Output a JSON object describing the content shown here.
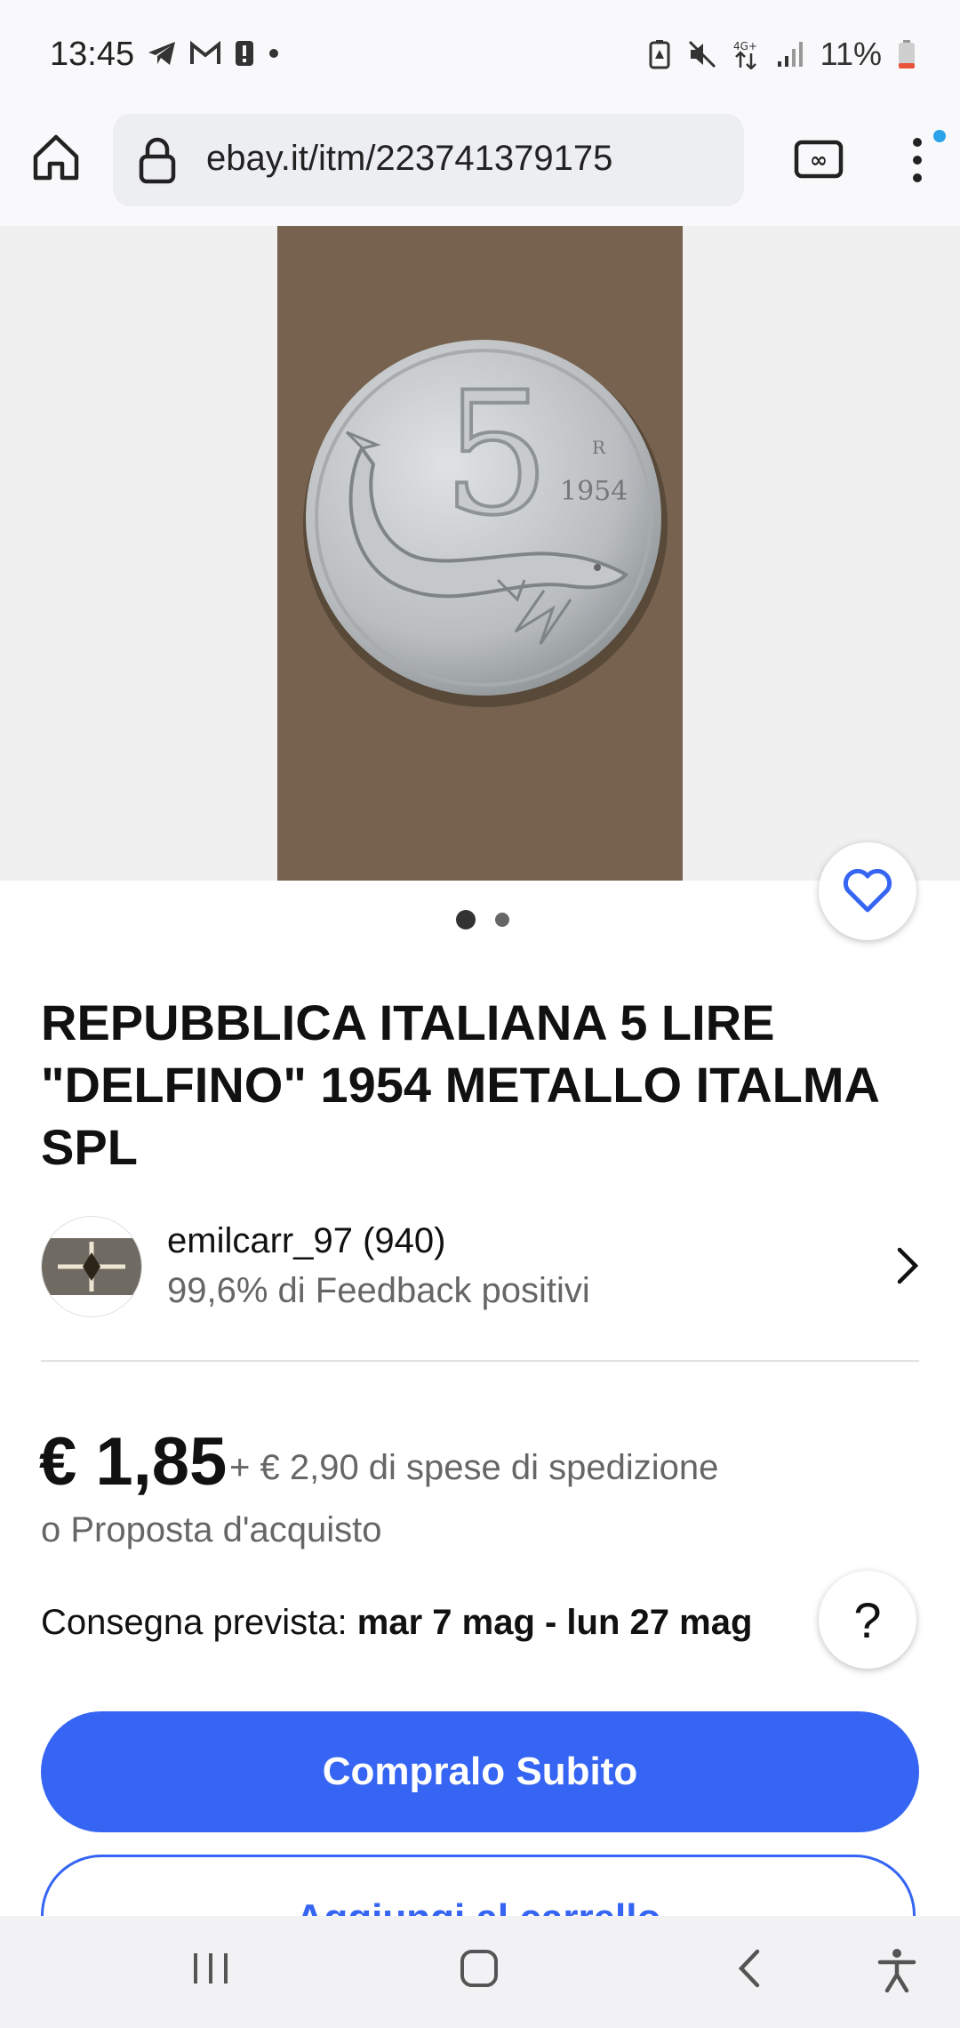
{
  "status": {
    "time": "13:45",
    "battery": "11%"
  },
  "browser": {
    "url": "ebay.it/itm/223741379175"
  },
  "listing": {
    "title": "REPUBBLICA ITALIANA 5 LIRE \"DELFINO\" 1954  METALLO ITALMA SPL",
    "coin_number": "5",
    "coin_year": "1954",
    "coin_mark": "R"
  },
  "seller": {
    "name": "emilcarr_97 (940)",
    "feedback": "99,6% di Feedback positivi"
  },
  "price": {
    "amount": "€ 1,85",
    "shipping": "+ € 2,90 di spese di spedizione",
    "offer": "o Proposta d'acquisto"
  },
  "delivery": {
    "label": "Consegna prevista:",
    "dates": "mar 7 mag - lun 27 mag"
  },
  "help_label": "?",
  "buttons": {
    "buy_now": "Compralo Subito",
    "add_to_cart": "Aggiungi al carrello"
  },
  "colors": {
    "accent": "#3665f3",
    "notify_dot": "#2aa3e8"
  }
}
